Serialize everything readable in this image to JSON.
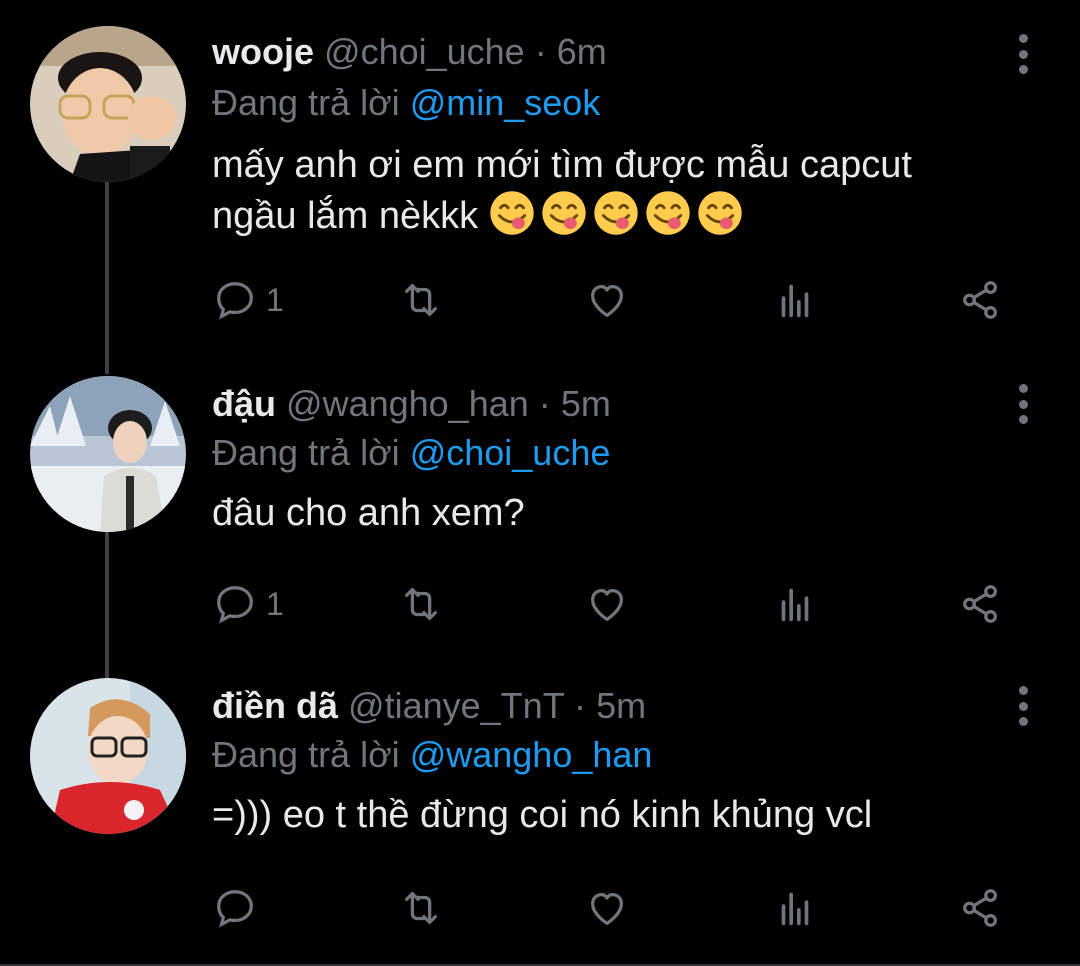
{
  "replies": [
    {
      "name": "wooje",
      "handle": "@choi_uche",
      "separator": "·",
      "time": "6m",
      "replying_prefix": "Đang trả lời",
      "replying_to": "@min_seok",
      "text_line1": "mấy anh ơi em mới tìm được mẫu capcut",
      "text_line2": "ngầu lắm nèkkk",
      "emoji_name": "face-savoring-food-emoji",
      "emoji_count": 5,
      "reply_count": "1",
      "avatar_icon": "avatar-wooje"
    },
    {
      "name": "đậu",
      "handle": "@wangho_han",
      "separator": "·",
      "time": "5m",
      "replying_prefix": "Đang trả lời",
      "replying_to": "@choi_uche",
      "text_line1": "đâu cho anh xem?",
      "reply_count": "1",
      "avatar_icon": "avatar-dau"
    },
    {
      "name": "điền dã",
      "handle": "@tianye_TnT",
      "separator": "·",
      "time": "5m",
      "replying_prefix": "Đang trả lời",
      "replying_to": "@wangho_han",
      "text_line1": "=))) eo t thề đừng coi nó kinh khủng vcl",
      "reply_count": "",
      "avatar_icon": "avatar-dien-da"
    }
  ],
  "icons": [
    "reply-icon",
    "retweet-icon",
    "like-icon",
    "analytics-icon",
    "share-icon",
    "more-options-icon"
  ],
  "colors": {
    "background": "#000000",
    "text": "#e7e9ea",
    "muted": "#71767b",
    "accent": "#1d9bf0",
    "thread_line": "#3d4146"
  }
}
